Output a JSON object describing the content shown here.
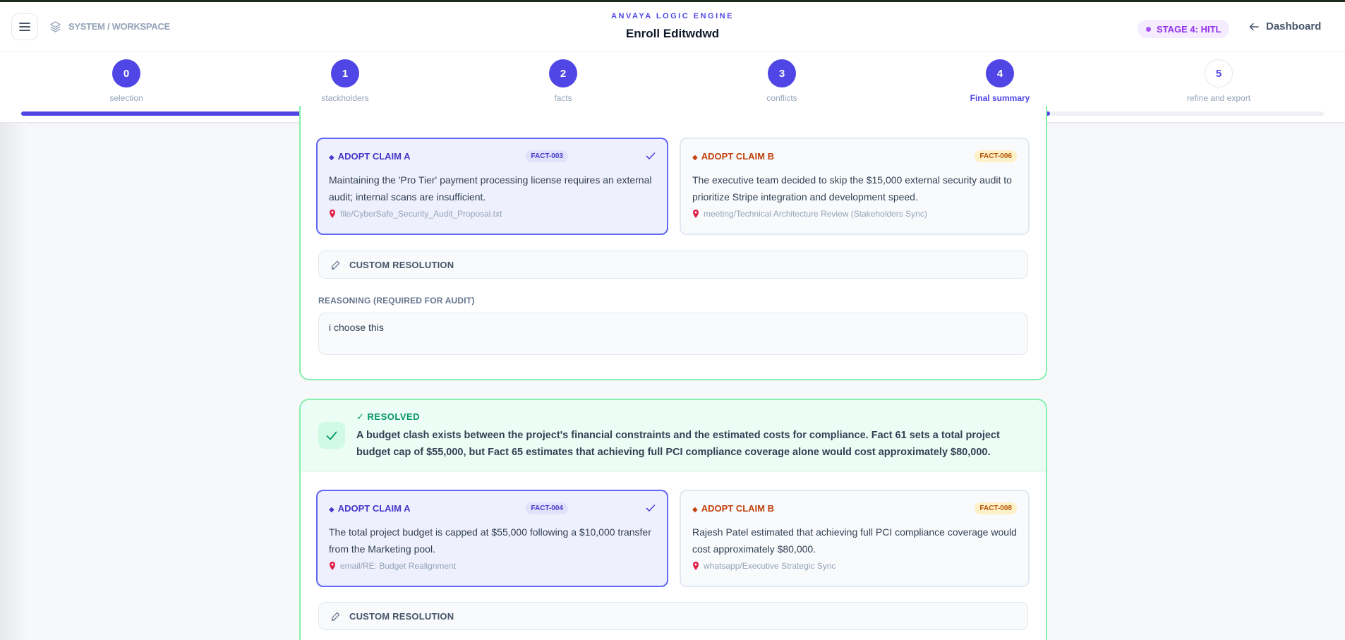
{
  "header": {
    "breadcrumb": "SYSTEM / WORKSPACE",
    "brand": "ANVAYA LOGIC ENGINE",
    "title": "Enroll Editwdwd",
    "stage_badge": "STAGE 4: HITL",
    "dashboard_label": "Dashboard"
  },
  "stepper": {
    "steps": [
      {
        "number": "0",
        "label": "selection"
      },
      {
        "number": "1",
        "label": "stackholders"
      },
      {
        "number": "2",
        "label": "facts"
      },
      {
        "number": "3",
        "label": "conflicts"
      },
      {
        "number": "4",
        "label": "Final summary"
      },
      {
        "number": "5",
        "label": "refine and export"
      }
    ],
    "active_step": 4,
    "progress": 0.79
  },
  "conflicts": [
    {
      "claim_a": {
        "label": "ADOPT CLAIM A",
        "fact_id": "FACT-003",
        "text": "Maintaining the 'Pro Tier' payment processing license requires an external audit; internal scans are insufficient.",
        "source": "file/CyberSafe_Security_Audit_Proposal.txt"
      },
      "claim_b": {
        "label": "ADOPT CLAIM B",
        "fact_id": "FACT-006",
        "text": "The executive team decided to skip the $15,000 external security audit to prioritize Stripe integration and development speed.",
        "source": "meeting/Technical Architecture Review (Stakeholders Sync)"
      },
      "custom_resolution_label": "CUSTOM RESOLUTION",
      "reasoning_label": "REASONING (REQUIRED FOR AUDIT)",
      "reasoning_value": "i choose this"
    },
    {
      "status": "✓ RESOLVED",
      "description": "A budget clash exists between the project's financial constraints and the estimated costs for compliance. Fact 61 sets a total project budget cap of $55,000, but Fact 65 estimates that achieving full PCI compliance coverage alone would cost approximately $80,000.",
      "claim_a": {
        "label": "ADOPT CLAIM A",
        "fact_id": "FACT-004",
        "text": "The total project budget is capped at $55,000 following a $10,000 transfer from the Marketing pool.",
        "source": "email/RE: Budget Realignment"
      },
      "claim_b": {
        "label": "ADOPT CLAIM B",
        "fact_id": "FACT-008",
        "text": "Rajesh Patel estimated that achieving full PCI compliance coverage would cost approximately $80,000.",
        "source": "whatsapp/Executive Strategic Sync"
      },
      "custom_resolution_label": "CUSTOM RESOLUTION"
    }
  ],
  "colors": {
    "accent": "#4f46e5",
    "resolved": "#059669",
    "claim_b": "#c2410c",
    "stage": "#9333ea"
  }
}
